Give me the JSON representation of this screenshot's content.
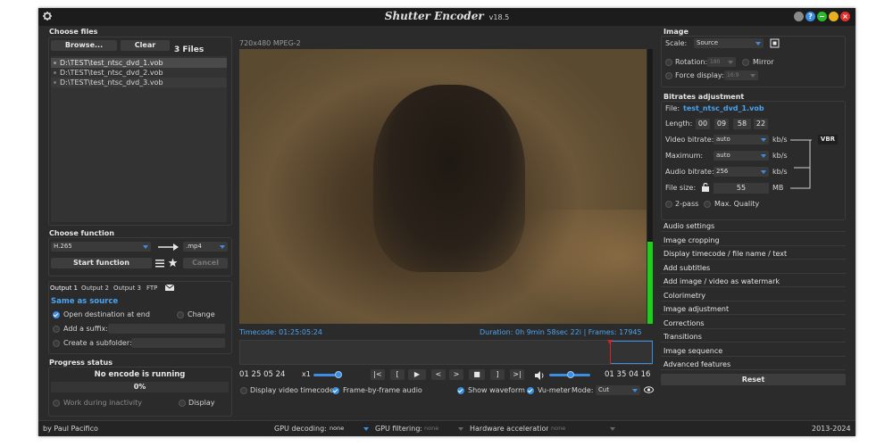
{
  "app": {
    "title": "Shutter Encoder",
    "version": "v18.5",
    "author": "by Paul Pacifico",
    "years": "2013-2024"
  },
  "colors": {
    "accent": "#3b8ee0",
    "vu_meter": "#19d119",
    "playhead": "#e02020",
    "minimize": "#2db82d",
    "info": "#3b8ee0",
    "close": "#e03030",
    "palette": "#7a7a7a",
    "settings": "#e8b020"
  },
  "choose_files": {
    "title": "Choose files",
    "browse_label": "Browse...",
    "clear_label": "Clear",
    "count_label": "3 Files",
    "files": [
      "D:\\TEST\\test_ntsc_dvd_1.vob",
      "D:\\TEST\\test_ntsc_dvd_2.vob",
      "D:\\TEST\\test_ntsc_dvd_3.vob"
    ]
  },
  "choose_function": {
    "title": "Choose function",
    "function": "H.265",
    "container": ".mp4",
    "start_label": "Start function",
    "cancel_label": "Cancel"
  },
  "output": {
    "tabs": [
      "Output 1",
      "Output 2",
      "Output 3",
      "FTP"
    ],
    "same_as_source": "Same as source",
    "open_destination": "Open destination at end",
    "change_label": "Change",
    "add_suffix": "Add a suffix:",
    "create_subfolder": "Create a subfolder:"
  },
  "progress": {
    "title": "Progress status",
    "status": "No encode is running",
    "percent": "0%",
    "work_inactivity": "Work during inactivity",
    "display_label": "Display"
  },
  "player": {
    "info": "720x480 MPEG-2",
    "timecode": "Timecode: 01:25:05:24",
    "duration": "Duration: 0h 9min 58sec 22i | Frames: 17945",
    "in_tc": [
      "01",
      "25",
      "05",
      "24"
    ],
    "out_tc": [
      "01",
      "35",
      "04",
      "16"
    ],
    "speed": "x1",
    "buttons": [
      "|<",
      "[",
      "▶",
      "<",
      ">",
      "■",
      "]",
      ">|"
    ],
    "display_timecode": "Display video timecode",
    "frame_audio": "Frame-by-frame audio",
    "show_waveform": "Show waveform",
    "vu_meter": "Vu-meter",
    "mode_label": "Mode:",
    "mode_value": "Cut",
    "vu_level": 0.3
  },
  "image": {
    "title": "Image",
    "scale_label": "Scale:",
    "scale_value": "Source",
    "rotation_label": "Rotation:",
    "rotation_value": "180",
    "mirror_label": "Mirror",
    "force_display_label": "Force display:",
    "force_display_value": "16:9"
  },
  "bitrates": {
    "title": "Bitrates adjustment",
    "file_label": "File:",
    "file_value": "test_ntsc_dvd_1.vob",
    "length_label": "Length:",
    "length": [
      "00",
      "09",
      "58",
      "22"
    ],
    "video_bitrate_label": "Video bitrate:",
    "video_bitrate": "auto",
    "maximum_label": "Maximum:",
    "maximum": "auto",
    "audio_bitrate_label": "Audio bitrate:",
    "audio_bitrate": "256",
    "file_size_label": "File size:",
    "file_size": "55",
    "kbs": "kb/s",
    "mb": "MB",
    "vbr": "VBR",
    "two_pass": "2-pass",
    "max_quality": "Max. Quality"
  },
  "accordion": [
    "Audio settings",
    "Image cropping",
    "Display timecode / file name / text",
    "Add subtitles",
    "Add image / video as watermark",
    "Colorimetry",
    "Image adjustment",
    "Corrections",
    "Transitions",
    "Image sequence",
    "Advanced features"
  ],
  "reset_label": "Reset",
  "status_bar": {
    "gpu_decoding_label": "GPU decoding:",
    "gpu_decoding": "none",
    "gpu_filtering_label": "GPU filtering:",
    "gpu_filtering": "none",
    "hw_accel_label": "Hardware acceleration:",
    "hw_accel": "none"
  }
}
